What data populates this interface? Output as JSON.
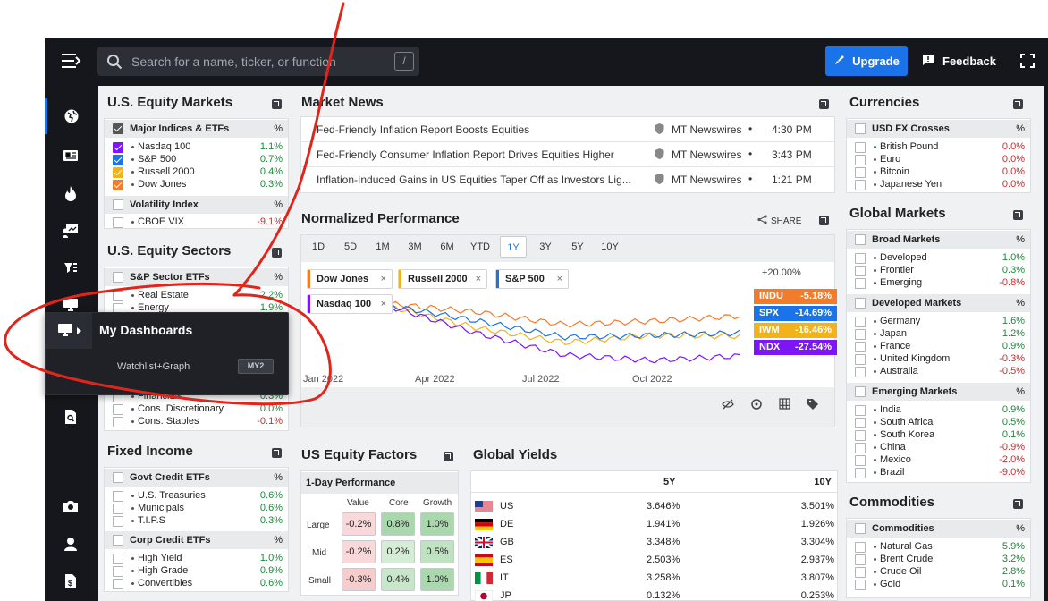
{
  "topbar": {
    "search_placeholder": "Search for a name, ticker, or function",
    "search_shortcut": "/",
    "upgrade_label": "Upgrade",
    "feedback_label": "Feedback"
  },
  "sidebar": {
    "icons": [
      "globe-icon",
      "news-icon",
      "fire-icon",
      "presentation-icon",
      "dashboard-filter-icon",
      "monitor-icon",
      "grid-icon",
      "line-chart-icon",
      "document-search-icon",
      "camera-icon",
      "user-icon",
      "dollar-document-icon"
    ]
  },
  "popup": {
    "title": "My Dashboards",
    "item_label": "Watchlist+Graph",
    "item_tag": "MY2"
  },
  "equity_markets": {
    "title": "U.S. Equity Markets",
    "group1": {
      "label": "Major Indices & ETFs",
      "pct": "%"
    },
    "rows": [
      {
        "name": "Nasdaq 100",
        "value": "1.1%",
        "color": "#7c16f5"
      },
      {
        "name": "S&P 500",
        "value": "0.7%",
        "color": "#1a73e8"
      },
      {
        "name": "Russell 2000",
        "value": "0.4%",
        "color": "#f2b21b"
      },
      {
        "name": "Dow Jones",
        "value": "0.3%",
        "color": "#f07c2c"
      }
    ],
    "group2": {
      "label": "Volatility Index",
      "pct": "%"
    },
    "vix": {
      "name": "CBOE VIX",
      "value": "-9.1%"
    }
  },
  "equity_sectors": {
    "title": "U.S. Equity Sectors",
    "group": {
      "label": "S&P Sector ETFs",
      "pct": "%"
    },
    "rows_top": [
      {
        "name": "Real Estate",
        "value": "2.2%"
      },
      {
        "name": "Energy",
        "value": "1.9%"
      }
    ],
    "rows_bottom": [
      {
        "name": "Financials",
        "value": "0.3%"
      },
      {
        "name": "Cons. Discretionary",
        "value": "0.0%"
      },
      {
        "name": "Cons. Staples",
        "value": "-0.1%"
      }
    ]
  },
  "fixed_income": {
    "title": "Fixed Income",
    "group1": {
      "label": "Govt Credit ETFs",
      "pct": "%"
    },
    "rows1": [
      {
        "name": "U.S. Treasuries",
        "value": "0.6%"
      },
      {
        "name": "Municipals",
        "value": "0.6%"
      },
      {
        "name": "T.I.P.S",
        "value": "0.3%"
      }
    ],
    "group2": {
      "label": "Corp Credit ETFs",
      "pct": "%"
    },
    "rows2": [
      {
        "name": "High Yield",
        "value": "1.0%"
      },
      {
        "name": "High Grade",
        "value": "0.9%"
      },
      {
        "name": "Convertibles",
        "value": "0.6%"
      }
    ]
  },
  "news": {
    "title": "Market News",
    "items": [
      {
        "headline": "Fed-Friendly Inflation Report Boosts Equities",
        "source": "MT Newswires",
        "bullet": "•",
        "time": "4:30 PM"
      },
      {
        "headline": "Fed-Friendly Consumer Inflation Report Drives Equities Higher",
        "source": "MT Newswires",
        "bullet": "•",
        "time": "3:43 PM"
      },
      {
        "headline": "Inflation-Induced Gains in US Equities Taper Off as Investors Lig...",
        "source": "MT Newswires",
        "bullet": "•",
        "time": "1:21 PM"
      }
    ]
  },
  "performance": {
    "title": "Normalized Performance",
    "share_label": "SHARE",
    "timeframes": [
      "1D",
      "5D",
      "1M",
      "3M",
      "6M",
      "YTD",
      "1Y",
      "3Y",
      "5Y",
      "10Y"
    ],
    "selected_timeframe": "1Y",
    "chips": [
      {
        "label": "Dow Jones",
        "color": "#f07c2c"
      },
      {
        "label": "Russell 2000",
        "color": "#f2b21b"
      },
      {
        "label": "S&P 500",
        "color": "#1a73e8"
      },
      {
        "label": "Nasdaq 100",
        "color": "#7c16f5"
      }
    ],
    "chip_close": "×",
    "y_top_label": "+20.00%",
    "badges": [
      {
        "ticker": "INDU",
        "value": "-5.18%",
        "color": "#f07c2c"
      },
      {
        "ticker": "SPX",
        "value": "-14.69%",
        "color": "#1a73e8"
      },
      {
        "ticker": "IWM",
        "value": "-16.46%",
        "color": "#f2b21b"
      },
      {
        "ticker": "NDX",
        "value": "-27.54%",
        "color": "#7c16f5"
      }
    ],
    "x_ticks": [
      "Jan 2022",
      "Apr 2022",
      "Jul 2022",
      "Oct 2022"
    ]
  },
  "chart_data": {
    "type": "line",
    "x": [
      "Jan 2022",
      "Apr 2022",
      "Jul 2022",
      "Oct 2022",
      "Dec 2022"
    ],
    "series": [
      {
        "name": "Dow Jones",
        "values": [
          1.5,
          -3.0,
          -10.0,
          -8.0,
          -5.18
        ]
      },
      {
        "name": "Russell 2000",
        "values": [
          0,
          -12.0,
          -20.0,
          -16.0,
          -16.46
        ]
      },
      {
        "name": "S&P 500",
        "values": [
          0.5,
          -8.0,
          -17.0,
          -16.0,
          -14.69
        ]
      },
      {
        "name": "Nasdaq 100",
        "values": [
          0,
          -15.0,
          -27.0,
          -30.0,
          -27.54
        ]
      }
    ],
    "ylabel": "",
    "y_top_tick": "+20.00%"
  },
  "factors": {
    "title": "US Equity Factors",
    "subtitle": "1-Day Performance",
    "cols": [
      "Value",
      "Core",
      "Growth"
    ],
    "rows": [
      {
        "label": "Large",
        "values": [
          "-0.2%",
          "0.8%",
          "1.0%"
        ]
      },
      {
        "label": "Mid",
        "values": [
          "-0.2%",
          "0.2%",
          "0.5%"
        ]
      },
      {
        "label": "Small",
        "values": [
          "-0.3%",
          "0.4%",
          "1.0%"
        ]
      }
    ]
  },
  "yields": {
    "title": "Global Yields",
    "cols": [
      "5Y",
      "10Y"
    ],
    "rows": [
      {
        "country": "US",
        "y5": "3.646%",
        "y10": "3.501%"
      },
      {
        "country": "DE",
        "y5": "1.941%",
        "y10": "1.926%"
      },
      {
        "country": "GB",
        "y5": "3.348%",
        "y10": "3.304%"
      },
      {
        "country": "ES",
        "y5": "2.503%",
        "y10": "2.937%"
      },
      {
        "country": "IT",
        "y5": "3.258%",
        "y10": "3.807%"
      },
      {
        "country": "JP",
        "y5": "0.132%",
        "y10": "0.253%"
      }
    ]
  },
  "currencies": {
    "title": "Currencies",
    "group": {
      "label": "USD FX Crosses",
      "pct": "%"
    },
    "rows": [
      {
        "name": "British Pound",
        "value": "0.0%"
      },
      {
        "name": "Euro",
        "value": "0.0%"
      },
      {
        "name": "Bitcoin",
        "value": "0.0%"
      },
      {
        "name": "Japanese Yen",
        "value": "0.0%"
      }
    ]
  },
  "global_markets": {
    "title": "Global Markets",
    "broad": {
      "label": "Broad Markets",
      "pct": "%",
      "rows": [
        {
          "name": "Developed",
          "value": "1.0%"
        },
        {
          "name": "Frontier",
          "value": "0.3%"
        },
        {
          "name": "Emerging",
          "value": "-0.8%"
        }
      ]
    },
    "developed": {
      "label": "Developed Markets",
      "pct": "%",
      "rows": [
        {
          "name": "Germany",
          "value": "1.6%"
        },
        {
          "name": "Japan",
          "value": "1.2%"
        },
        {
          "name": "France",
          "value": "0.9%"
        },
        {
          "name": "United Kingdom",
          "value": "-0.3%"
        },
        {
          "name": "Australia",
          "value": "-0.5%"
        }
      ]
    },
    "emerging": {
      "label": "Emerging Markets",
      "pct": "%",
      "rows": [
        {
          "name": "India",
          "value": "0.9%"
        },
        {
          "name": "South Africa",
          "value": "0.5%"
        },
        {
          "name": "South Korea",
          "value": "0.1%"
        },
        {
          "name": "China",
          "value": "-0.9%"
        },
        {
          "name": "Mexico",
          "value": "-2.0%"
        },
        {
          "name": "Brazil",
          "value": "-9.0%"
        }
      ]
    }
  },
  "commodities": {
    "title": "Commodities",
    "group": {
      "label": "Commodities",
      "pct": "%"
    },
    "rows": [
      {
        "name": "Natural Gas",
        "value": "5.9%"
      },
      {
        "name": "Brent Crude",
        "value": "3.2%"
      },
      {
        "name": "Crude Oil",
        "value": "2.8%"
      },
      {
        "name": "Gold",
        "value": "0.1%"
      }
    ]
  }
}
